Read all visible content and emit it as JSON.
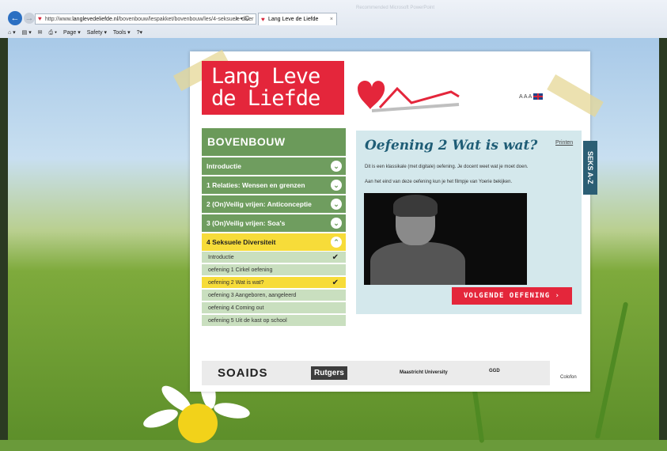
{
  "browser": {
    "url_prefix": "http://www.",
    "url_domain": "langlevedeliefde.nl",
    "url_path": "/bovenbouw/lespakket/bovenbouw/les/4-seksuele-diver",
    "url_tools": "⌕ ▾ C",
    "tab_title": "Lang Leve de Liefde",
    "faint_bar": "Recommended    Microsoft PowerPoint",
    "toolbar": {
      "page": "Page ▾",
      "safety": "Safety ▾",
      "tools": "Tools ▾",
      "help": "?▾"
    }
  },
  "site": {
    "logo_line1": "Lang Leve",
    "logo_line2": "de Liefde",
    "font_sizes": "A A A"
  },
  "sidebar": {
    "title": "BOVENBOUW",
    "sections": [
      {
        "label": "Introductie"
      },
      {
        "label": "1 Relaties: Wensen en grenzen"
      },
      {
        "label": "2 (On)Veilig vrijen: Anticonceptie"
      },
      {
        "label": "3 (On)Veilig vrijen: Soa's"
      },
      {
        "label": "4 Seksuele Diversiteit"
      }
    ],
    "subitems": [
      {
        "label": "Introductie",
        "done": "✔"
      },
      {
        "label": "oefening 1 Cirkel oefening",
        "done": ""
      },
      {
        "label": "oefening 2 Wat is wat?",
        "done": "✔"
      },
      {
        "label": "oefening 3 Aangeboren, aangeleerd",
        "done": ""
      },
      {
        "label": "oefening 4 Coming out",
        "done": ""
      },
      {
        "label": "oefening 5 Uit de kast op school",
        "done": ""
      }
    ]
  },
  "exercise": {
    "title": "Oefening 2 Wat is wat?",
    "print_link": "Printen",
    "text1": "Dit is een klassikale (met digitale) oefening. Je docent weet wat je moet doen.",
    "text2": "Aan het eind van deze oefening kun je het filmpje van Yoerie bekijken.",
    "next_button": "VOLGENDE OEFENING  ›"
  },
  "seks_az": "SEKS A-Z",
  "footer": {
    "sponsors": [
      "SOAIDS",
      "Rutgers",
      "Maastricht University",
      "GGD"
    ],
    "colofon": "Colofon"
  },
  "colors": {
    "brand_red": "#e4263b",
    "green": "#6f9d5f",
    "yellow": "#f7dc39",
    "panel_blue": "#d4e8ec"
  }
}
